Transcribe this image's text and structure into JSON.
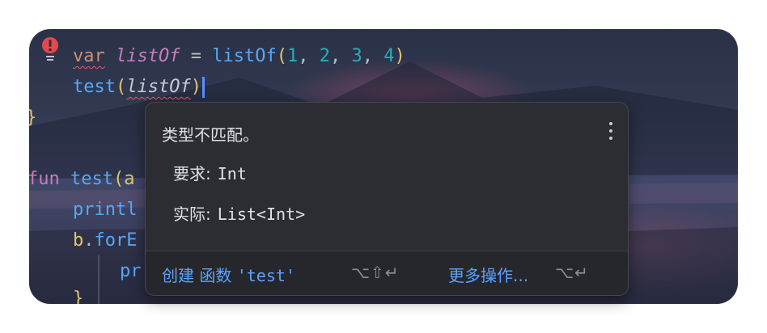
{
  "editor": {
    "line1": {
      "keyword": "var",
      "variable": "listOf",
      "op": " = ",
      "call": "listOf",
      "open": "(",
      "args": [
        {
          "n": "1",
          "sep": ", "
        },
        {
          "n": "2",
          "sep": ", "
        },
        {
          "n": "3",
          "sep": ", "
        },
        {
          "n": "4",
          "sep": ""
        }
      ],
      "close": ")"
    },
    "line2": {
      "call": "test",
      "open": "(",
      "arg": "listOf",
      "close": ")"
    },
    "line3": {
      "brace": "}"
    },
    "line4": {
      "keyword": "fun",
      "call": "test",
      "open": "(",
      "rest": "a"
    },
    "line5": {
      "call": "printl"
    },
    "line6": {
      "obj": "b",
      "dot": ".",
      "call": "forE"
    },
    "line7": {
      "call": "pr"
    },
    "line8": {
      "brace": "}"
    }
  },
  "popup": {
    "title": "类型不匹配。",
    "required_label": "要求:",
    "required_value": "Int",
    "actual_label": "实际:",
    "actual_value": "List<Int>",
    "actions": [
      {
        "label": "创建 函数 ",
        "code": "'test'",
        "shortcut": "⌥⇧↵"
      },
      {
        "label": "更多操作...",
        "shortcut": "⌥↵"
      }
    ]
  },
  "colors": {
    "keyword": "#cf8e6d",
    "function": "#56a8f5",
    "number": "#2aacb8",
    "variable": "#c77dbb",
    "error": "#f75464",
    "link": "#5ea1ff"
  },
  "icons": [
    "error-bulb-icon",
    "more-vertical-icon"
  ]
}
